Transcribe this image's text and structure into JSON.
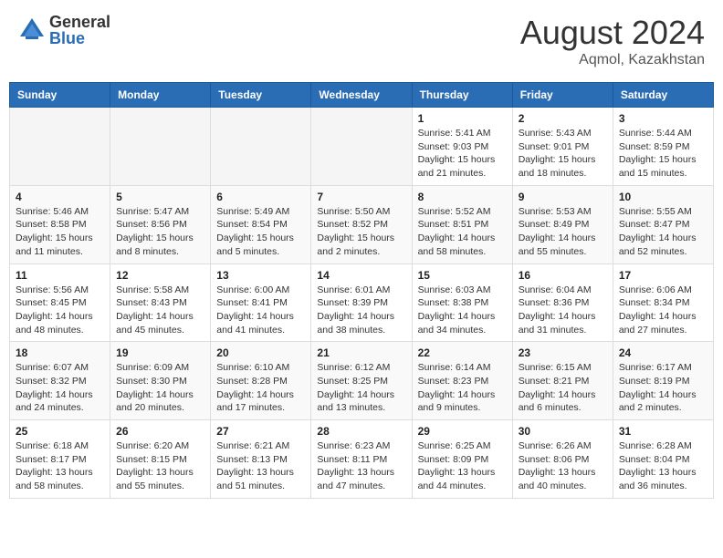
{
  "header": {
    "logo_general": "General",
    "logo_blue": "Blue",
    "main_title": "August 2024",
    "subtitle": "Aqmol, Kazakhstan"
  },
  "days_of_week": [
    "Sunday",
    "Monday",
    "Tuesday",
    "Wednesday",
    "Thursday",
    "Friday",
    "Saturday"
  ],
  "weeks": [
    [
      {
        "day": "",
        "info": ""
      },
      {
        "day": "",
        "info": ""
      },
      {
        "day": "",
        "info": ""
      },
      {
        "day": "",
        "info": ""
      },
      {
        "day": "1",
        "info": "Sunrise: 5:41 AM\nSunset: 9:03 PM\nDaylight: 15 hours and 21 minutes."
      },
      {
        "day": "2",
        "info": "Sunrise: 5:43 AM\nSunset: 9:01 PM\nDaylight: 15 hours and 18 minutes."
      },
      {
        "day": "3",
        "info": "Sunrise: 5:44 AM\nSunset: 8:59 PM\nDaylight: 15 hours and 15 minutes."
      }
    ],
    [
      {
        "day": "4",
        "info": "Sunrise: 5:46 AM\nSunset: 8:58 PM\nDaylight: 15 hours and 11 minutes."
      },
      {
        "day": "5",
        "info": "Sunrise: 5:47 AM\nSunset: 8:56 PM\nDaylight: 15 hours and 8 minutes."
      },
      {
        "day": "6",
        "info": "Sunrise: 5:49 AM\nSunset: 8:54 PM\nDaylight: 15 hours and 5 minutes."
      },
      {
        "day": "7",
        "info": "Sunrise: 5:50 AM\nSunset: 8:52 PM\nDaylight: 15 hours and 2 minutes."
      },
      {
        "day": "8",
        "info": "Sunrise: 5:52 AM\nSunset: 8:51 PM\nDaylight: 14 hours and 58 minutes."
      },
      {
        "day": "9",
        "info": "Sunrise: 5:53 AM\nSunset: 8:49 PM\nDaylight: 14 hours and 55 minutes."
      },
      {
        "day": "10",
        "info": "Sunrise: 5:55 AM\nSunset: 8:47 PM\nDaylight: 14 hours and 52 minutes."
      }
    ],
    [
      {
        "day": "11",
        "info": "Sunrise: 5:56 AM\nSunset: 8:45 PM\nDaylight: 14 hours and 48 minutes."
      },
      {
        "day": "12",
        "info": "Sunrise: 5:58 AM\nSunset: 8:43 PM\nDaylight: 14 hours and 45 minutes."
      },
      {
        "day": "13",
        "info": "Sunrise: 6:00 AM\nSunset: 8:41 PM\nDaylight: 14 hours and 41 minutes."
      },
      {
        "day": "14",
        "info": "Sunrise: 6:01 AM\nSunset: 8:39 PM\nDaylight: 14 hours and 38 minutes."
      },
      {
        "day": "15",
        "info": "Sunrise: 6:03 AM\nSunset: 8:38 PM\nDaylight: 14 hours and 34 minutes."
      },
      {
        "day": "16",
        "info": "Sunrise: 6:04 AM\nSunset: 8:36 PM\nDaylight: 14 hours and 31 minutes."
      },
      {
        "day": "17",
        "info": "Sunrise: 6:06 AM\nSunset: 8:34 PM\nDaylight: 14 hours and 27 minutes."
      }
    ],
    [
      {
        "day": "18",
        "info": "Sunrise: 6:07 AM\nSunset: 8:32 PM\nDaylight: 14 hours and 24 minutes."
      },
      {
        "day": "19",
        "info": "Sunrise: 6:09 AM\nSunset: 8:30 PM\nDaylight: 14 hours and 20 minutes."
      },
      {
        "day": "20",
        "info": "Sunrise: 6:10 AM\nSunset: 8:28 PM\nDaylight: 14 hours and 17 minutes."
      },
      {
        "day": "21",
        "info": "Sunrise: 6:12 AM\nSunset: 8:25 PM\nDaylight: 14 hours and 13 minutes."
      },
      {
        "day": "22",
        "info": "Sunrise: 6:14 AM\nSunset: 8:23 PM\nDaylight: 14 hours and 9 minutes."
      },
      {
        "day": "23",
        "info": "Sunrise: 6:15 AM\nSunset: 8:21 PM\nDaylight: 14 hours and 6 minutes."
      },
      {
        "day": "24",
        "info": "Sunrise: 6:17 AM\nSunset: 8:19 PM\nDaylight: 14 hours and 2 minutes."
      }
    ],
    [
      {
        "day": "25",
        "info": "Sunrise: 6:18 AM\nSunset: 8:17 PM\nDaylight: 13 hours and 58 minutes."
      },
      {
        "day": "26",
        "info": "Sunrise: 6:20 AM\nSunset: 8:15 PM\nDaylight: 13 hours and 55 minutes."
      },
      {
        "day": "27",
        "info": "Sunrise: 6:21 AM\nSunset: 8:13 PM\nDaylight: 13 hours and 51 minutes."
      },
      {
        "day": "28",
        "info": "Sunrise: 6:23 AM\nSunset: 8:11 PM\nDaylight: 13 hours and 47 minutes."
      },
      {
        "day": "29",
        "info": "Sunrise: 6:25 AM\nSunset: 8:09 PM\nDaylight: 13 hours and 44 minutes."
      },
      {
        "day": "30",
        "info": "Sunrise: 6:26 AM\nSunset: 8:06 PM\nDaylight: 13 hours and 40 minutes."
      },
      {
        "day": "31",
        "info": "Sunrise: 6:28 AM\nSunset: 8:04 PM\nDaylight: 13 hours and 36 minutes."
      }
    ]
  ]
}
